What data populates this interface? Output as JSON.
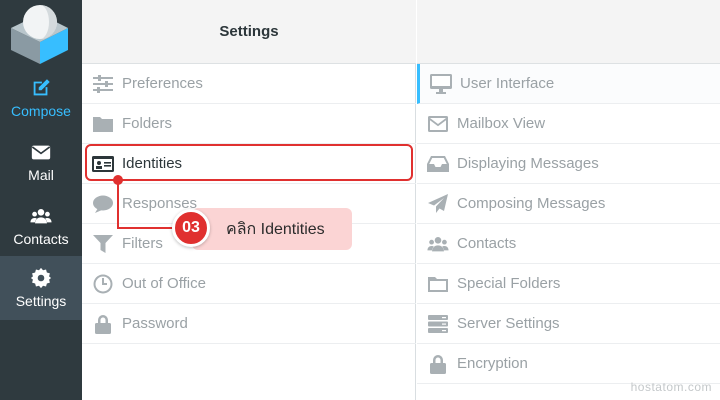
{
  "nav": {
    "items": [
      {
        "label": "Compose",
        "icon": "compose-icon"
      },
      {
        "label": "Mail",
        "icon": "mail-icon"
      },
      {
        "label": "Contacts",
        "icon": "contacts-icon"
      },
      {
        "label": "Settings",
        "icon": "settings-icon",
        "active": true
      }
    ],
    "accent_color": "#37beff",
    "background_color": "#2f3a3f"
  },
  "settings": {
    "title": "Settings",
    "items": [
      {
        "label": "Preferences",
        "icon": "sliders-icon"
      },
      {
        "label": "Folders",
        "icon": "folder-icon"
      },
      {
        "label": "Identities",
        "icon": "id-card-icon",
        "selected": true
      },
      {
        "label": "Responses",
        "icon": "comment-icon"
      },
      {
        "label": "Filters",
        "icon": "filter-icon"
      },
      {
        "label": "Out of Office",
        "icon": "clock-icon"
      },
      {
        "label": "Password",
        "icon": "lock-icon"
      }
    ]
  },
  "preferences": {
    "items": [
      {
        "label": "User Interface",
        "icon": "monitor-icon"
      },
      {
        "label": "Mailbox View",
        "icon": "envelope-icon"
      },
      {
        "label": "Displaying Messages",
        "icon": "inbox-icon"
      },
      {
        "label": "Composing Messages",
        "icon": "paper-plane-icon"
      },
      {
        "label": "Contacts",
        "icon": "users-icon"
      },
      {
        "label": "Special Folders",
        "icon": "folder-outline-icon"
      },
      {
        "label": "Server Settings",
        "icon": "server-icon"
      },
      {
        "label": "Encryption",
        "icon": "lock-icon"
      }
    ]
  },
  "annotation": {
    "step": "03",
    "text": "คลิก Identities",
    "color": "#e0302f"
  },
  "watermark": "hostatom.com"
}
